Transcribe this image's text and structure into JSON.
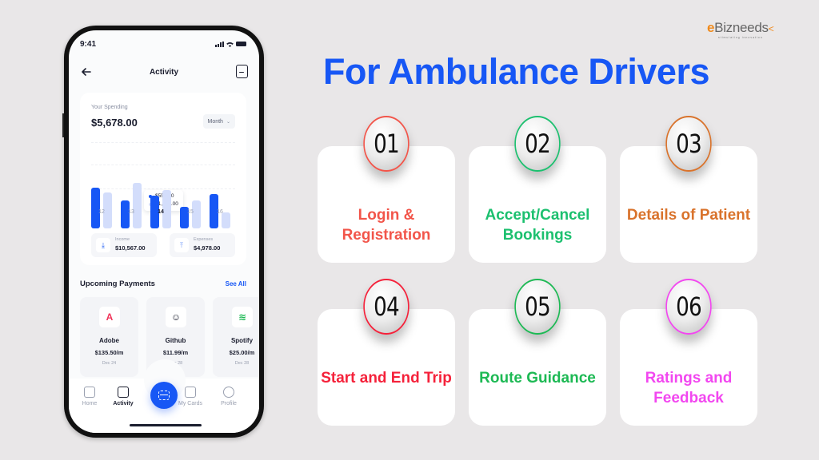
{
  "brand": {
    "name_prefix": "e",
    "name_rest": "Bizneeds",
    "name_suffix": "<",
    "tagline": "stimulating innovation",
    "accent_color": "#f08a1c"
  },
  "headline": "For Ambulance Drivers",
  "features": [
    {
      "number": "01",
      "title": "Login & Registration",
      "color": "#f2554a"
    },
    {
      "number": "02",
      "title": "Accept/Cancel Bookings",
      "color": "#1cc06f"
    },
    {
      "number": "03",
      "title": "Details of Patient",
      "color": "#d9732c"
    },
    {
      "number": "04",
      "title": "Start and End Trip",
      "color": "#f5213a"
    },
    {
      "number": "05",
      "title": "Route Guidance",
      "color": "#1db954"
    },
    {
      "number": "06",
      "title": "Ratings and Feedback",
      "color": "#f247f0"
    }
  ],
  "phone": {
    "status_time": "9:41",
    "header": {
      "title": "Activity",
      "back_icon": "arrow-left-icon",
      "action_icon": "report-icon"
    },
    "spending": {
      "label": "Your Spending",
      "value": "$5,678.00",
      "period": "Month"
    },
    "chart_data": {
      "type": "bar",
      "categories": [
        "12",
        "13",
        "14",
        "15",
        "16"
      ],
      "active_category": "14",
      "series": [
        {
          "name": "dark",
          "color": "#1757f5",
          "values": [
            0.88,
            0.6,
            0.7,
            0.47,
            0.74
          ]
        },
        {
          "name": "light",
          "color": "#d3ddfb",
          "values": [
            0.77,
            0.98,
            0.82,
            0.6,
            0.34
          ]
        }
      ],
      "tooltip": {
        "category": "14",
        "rows": [
          "$557.00",
          "$1,200.00"
        ]
      }
    },
    "stats": [
      {
        "label": "Income",
        "value": "$10,567.00",
        "icon": "download-icon"
      },
      {
        "label": "Expenses",
        "value": "$4,978.00",
        "icon": "upload-icon"
      }
    ],
    "upcoming": {
      "title": "Upcoming Payments",
      "see_all": "See All",
      "items": [
        {
          "name": "Adobe",
          "price": "$135.50/m",
          "date": "Dec 24",
          "icon_glyph": "A",
          "icon_color": "#f0345a"
        },
        {
          "name": "Github",
          "price": "$11.99/m",
          "date": "Dec 28",
          "icon_glyph": "☺",
          "icon_color": "#1a1d2e"
        },
        {
          "name": "Spotify",
          "price": "$25.00/m",
          "date": "Dec 28",
          "icon_glyph": "≋",
          "icon_color": "#1db954"
        }
      ]
    },
    "tabs": [
      {
        "label": "Home",
        "active": false
      },
      {
        "label": "Activity",
        "active": true
      },
      {
        "label": "My Cards",
        "active": false
      },
      {
        "label": "Profile",
        "active": false
      }
    ]
  }
}
